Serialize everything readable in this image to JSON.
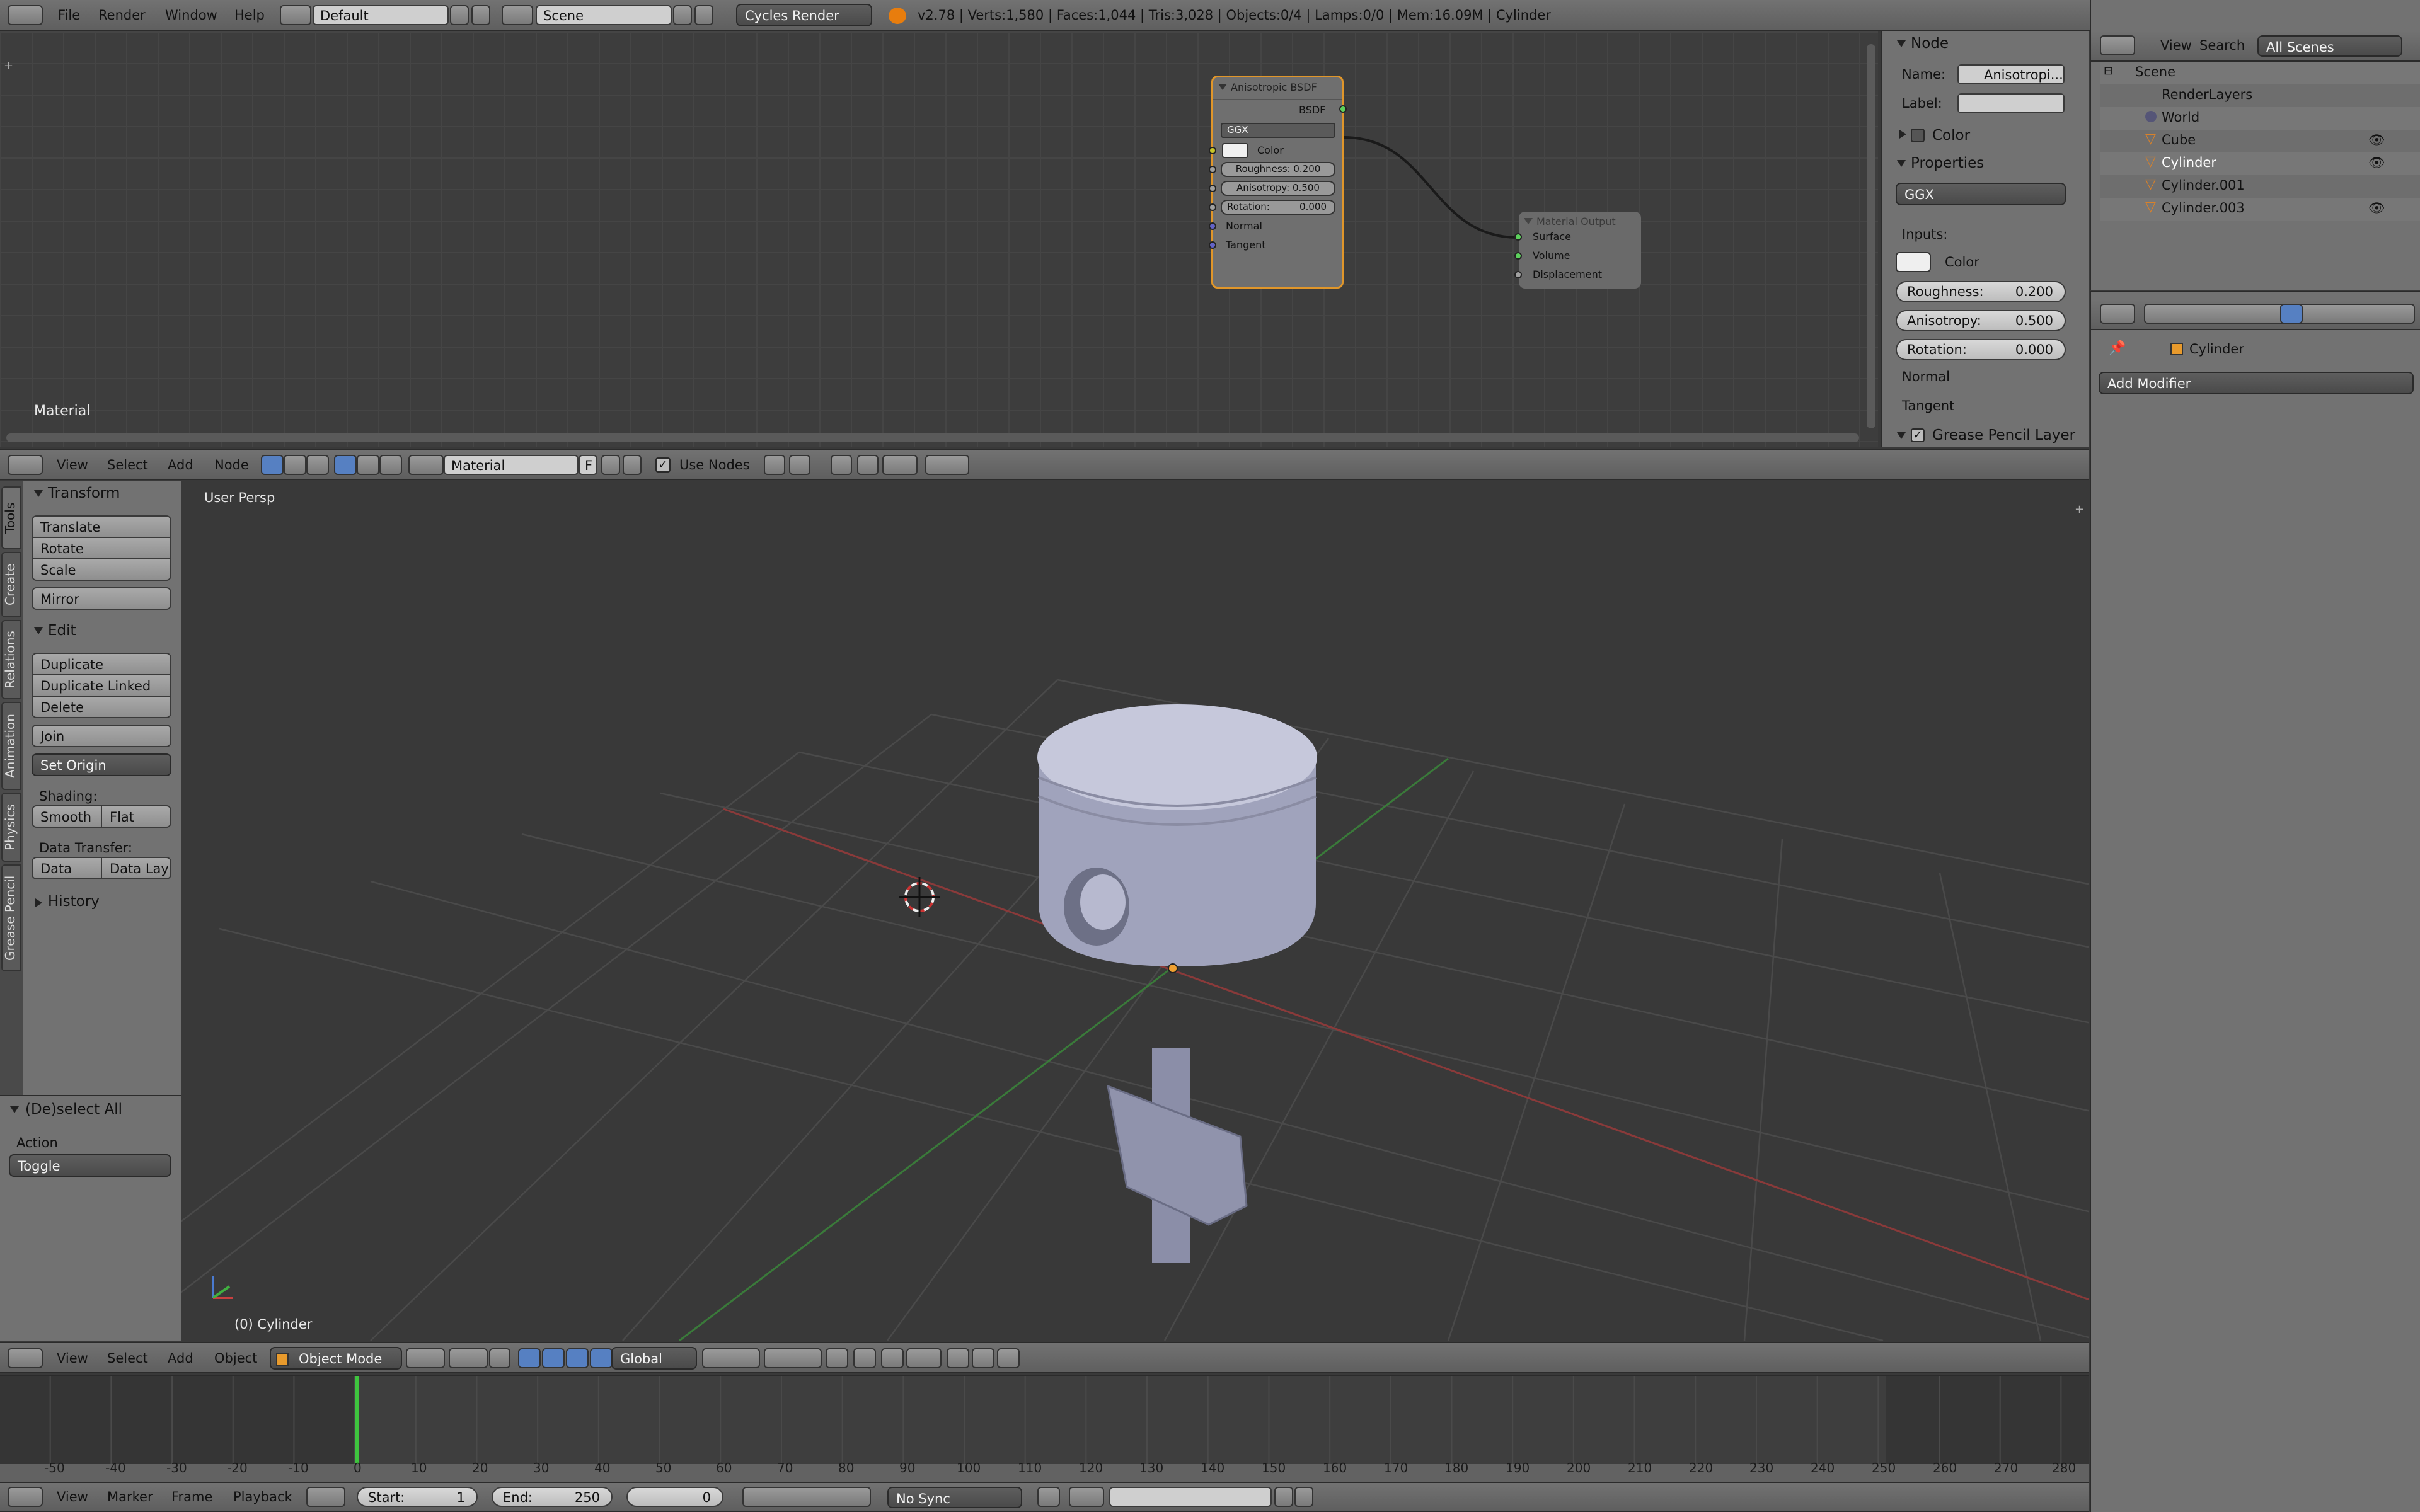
{
  "top_bar": {
    "menus": [
      "File",
      "Render",
      "Window",
      "Help"
    ],
    "screen_layout": "Default",
    "scene": "Scene",
    "render_engine": "Cycles Render",
    "stats": "v2.78 | Verts:1,580 | Faces:1,044 | Tris:3,028 | Objects:0/4 | Lamps:0/0 | Mem:16.09M | Cylinder"
  },
  "node_editor": {
    "area_label": "Material",
    "menus": [
      "View",
      "Select",
      "Add",
      "Node"
    ],
    "material_name": "Material",
    "fake_user": "F",
    "use_nodes_label": "Use Nodes",
    "bsdf_node": {
      "title": "Anisotropic BSDF",
      "output": "BSDF",
      "distribution": "GGX",
      "color_label": "Color",
      "roughness": "Roughness: 0.200",
      "anisotropy": "Anisotropy: 0.500",
      "rotation_label": "Rotation:",
      "rotation_value": "0.000",
      "normal": "Normal",
      "tangent": "Tangent"
    },
    "output_node": {
      "title": "Material Output",
      "inputs": [
        "Surface",
        "Volume",
        "Displacement"
      ]
    }
  },
  "node_sidebar": {
    "node_header": "Node",
    "name_label": "Name:",
    "name_value": "Anisotropi...",
    "label_label": "Label:",
    "color_header": "Color",
    "properties_header": "Properties",
    "distribution": "GGX",
    "inputs_label": "Inputs:",
    "color_label": "Color",
    "roughness_label": "Roughness:",
    "roughness_value": "0.200",
    "anisotropy_label": "Anisotropy:",
    "anisotropy_value": "0.500",
    "rotation_label": "Rotation:",
    "rotation_value": "0.000",
    "normal": "Normal",
    "tangent": "Tangent",
    "grease_pencil": "Grease Pencil Layer"
  },
  "outliner": {
    "menus": [
      "View",
      "Search"
    ],
    "filter": "All Scenes",
    "items": [
      {
        "label": "Scene"
      },
      {
        "label": "RenderLayers"
      },
      {
        "label": "World"
      },
      {
        "label": "Cube"
      },
      {
        "label": "Cylinder"
      },
      {
        "label": "Cylinder.001"
      },
      {
        "label": "Cylinder.003"
      }
    ]
  },
  "properties": {
    "object_name": "Cylinder",
    "add_modifier": "Add Modifier"
  },
  "tool_shelf": {
    "tabs": [
      "Tools",
      "Create",
      "Relations",
      "Animation",
      "Physics",
      "Grease Pencil"
    ],
    "transform_header": "Transform",
    "translate": "Translate",
    "rotate": "Rotate",
    "scale": "Scale",
    "mirror": "Mirror",
    "edit_header": "Edit",
    "duplicate": "Duplicate",
    "duplicate_linked": "Duplicate Linked",
    "delete": "Delete",
    "join": "Join",
    "set_origin": "Set Origin",
    "shading_label": "Shading:",
    "smooth": "Smooth",
    "flat": "Flat",
    "data_transfer_label": "Data Transfer:",
    "data": "Data",
    "data_lay": "Data Lay",
    "history_header": "History",
    "operator_header": "(De)select All",
    "action_label": "Action",
    "action_value": "Toggle"
  },
  "viewport": {
    "view_label": "User Persp",
    "object_label": "(0) Cylinder",
    "menus": [
      "View",
      "Select",
      "Add",
      "Object"
    ],
    "mode": "Object Mode",
    "orientation": "Global"
  },
  "timeline": {
    "ticks": [
      "-50",
      "-40",
      "-30",
      "-20",
      "-10",
      "0",
      "10",
      "20",
      "30",
      "40",
      "50",
      "60",
      "70",
      "80",
      "90",
      "100",
      "110",
      "120",
      "130",
      "140",
      "150",
      "160",
      "170",
      "180",
      "190",
      "200",
      "210",
      "220",
      "230",
      "240",
      "250",
      "260",
      "270",
      "280"
    ],
    "menus": [
      "View",
      "Marker",
      "Frame",
      "Playback"
    ],
    "start_label": "Start:",
    "start_value": "1",
    "end_label": "End:",
    "end_value": "250",
    "current_frame": "0",
    "sync": "No Sync"
  }
}
